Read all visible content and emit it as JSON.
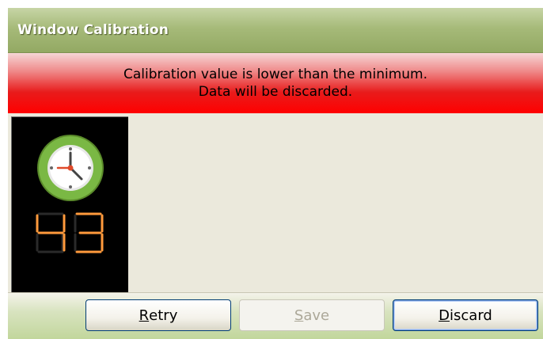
{
  "window": {
    "title": "Window Calibration"
  },
  "alert": {
    "line1": "Calibration value is lower than the minimum.",
    "line2": "Data will be discarded.",
    "color": "#ff0000"
  },
  "panel": {
    "icon": "clock-icon",
    "reading": "43",
    "digit_color": "#ff9a3c"
  },
  "buttons": {
    "retry": {
      "mnemonic": "R",
      "rest": "etry",
      "enabled": true
    },
    "save": {
      "mnemonic": "S",
      "rest": "ave",
      "enabled": false
    },
    "discard": {
      "mnemonic": "D",
      "rest": "iscard",
      "enabled": true
    }
  }
}
